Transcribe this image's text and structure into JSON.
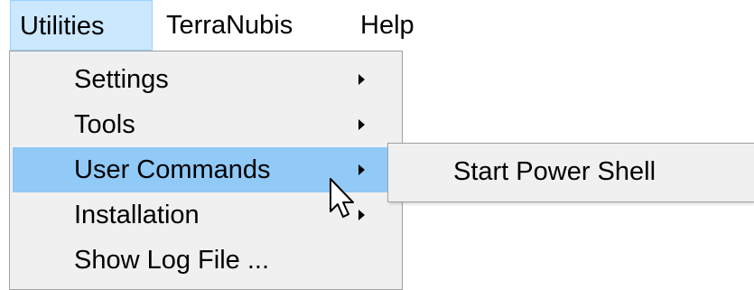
{
  "menubar": {
    "items": [
      {
        "label": "Utilities",
        "active": true
      },
      {
        "label": "TerraNubis",
        "active": false
      },
      {
        "label": "Help",
        "active": false
      }
    ]
  },
  "dropdown": {
    "items": [
      {
        "label": "Settings",
        "has_submenu": true,
        "highlighted": false
      },
      {
        "label": "Tools",
        "has_submenu": true,
        "highlighted": false
      },
      {
        "label": "User Commands",
        "has_submenu": true,
        "highlighted": true
      },
      {
        "label": "Installation",
        "has_submenu": true,
        "highlighted": false
      },
      {
        "label": "Show Log File ...",
        "has_submenu": false,
        "highlighted": false
      }
    ]
  },
  "submenu": {
    "items": [
      {
        "label": "Start Power Shell"
      }
    ]
  },
  "icons": {
    "submenu_arrow": "chevron-right-icon",
    "cursor": "mouse-pointer-icon"
  },
  "colors": {
    "menubar_active_bg": "#cce8ff",
    "menu_highlight_bg": "#91c9f7",
    "menu_bg": "#f0f0f0"
  }
}
